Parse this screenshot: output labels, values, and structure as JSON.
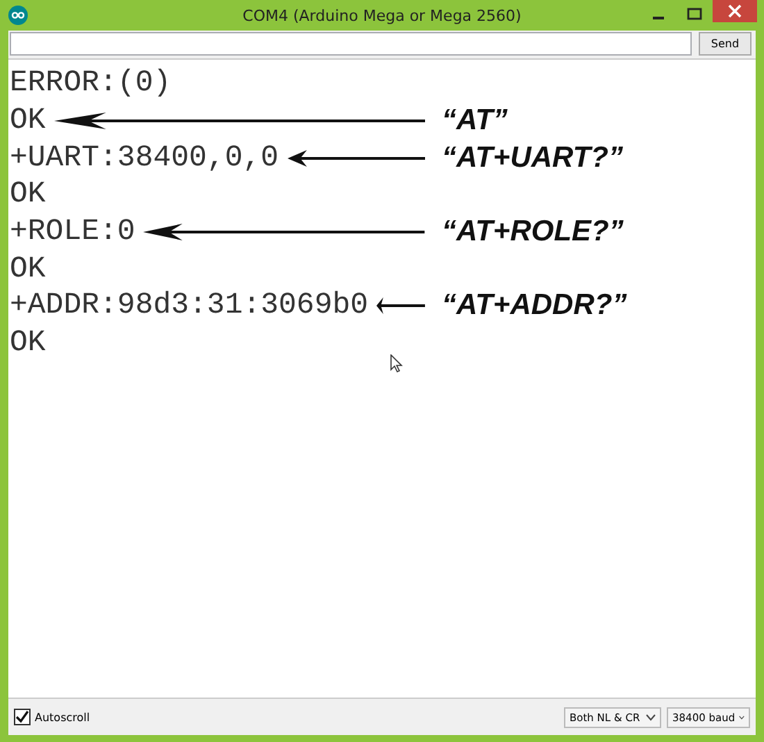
{
  "window": {
    "title": "COM4 (Arduino Mega or Mega 2560)"
  },
  "send_button": "Send",
  "output_lines": [
    {
      "text": "ERROR:(0)"
    },
    {
      "text": "OK",
      "annotation": "“AT”"
    },
    {
      "text": "+UART:38400,0,0",
      "annotation": "“AT+UART?”"
    },
    {
      "text": "OK"
    },
    {
      "text": "+ROLE:0",
      "annotation": "“AT+ROLE?”"
    },
    {
      "text": "OK"
    },
    {
      "text": "+ADDR:98d3:31:3069b0",
      "annotation": "“AT+ADDR?”"
    },
    {
      "text": "OK"
    }
  ],
  "autoscroll": {
    "label": "Autoscroll",
    "checked": true
  },
  "line_ending": "Both NL & CR",
  "baud_rate": "38400 baud"
}
